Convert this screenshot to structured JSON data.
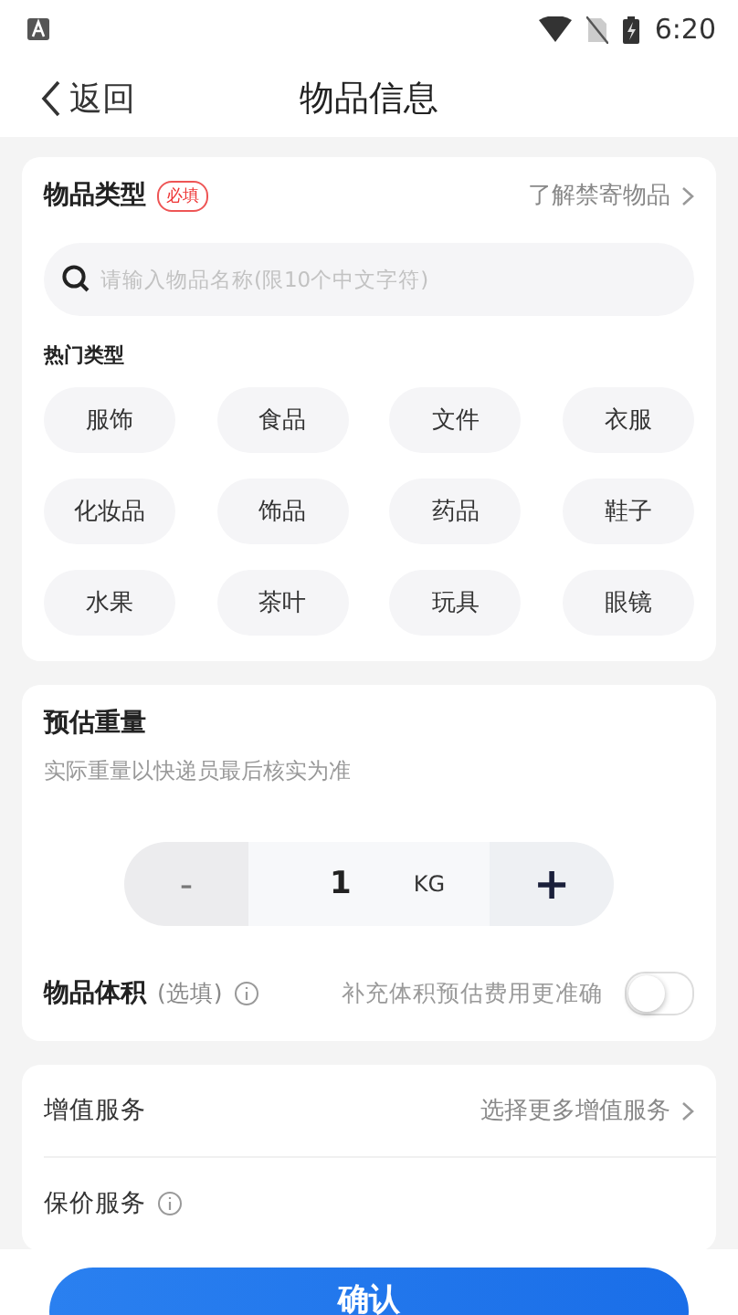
{
  "status_bar": {
    "time": "6:20"
  },
  "header": {
    "back": "返回",
    "title": "物品信息"
  },
  "item_type": {
    "title": "物品类型",
    "badge": "必填",
    "link": "了解禁寄物品",
    "search": {
      "placeholder": "请输入物品名称(限10个中文字符)"
    },
    "hot_label": "热门类型",
    "categories": [
      "服饰",
      "食品",
      "文件",
      "衣服",
      "化妆品",
      "饰品",
      "药品",
      "鞋子",
      "水果",
      "茶叶",
      "玩具",
      "眼镜"
    ]
  },
  "weight": {
    "title": "预估重量",
    "hint": "实际重量以快递员最后核实为准",
    "minus": "-",
    "value": "1",
    "unit": "KG",
    "plus": "+"
  },
  "volume": {
    "title": "物品体积",
    "optional": "(选填)",
    "hint": "补充体积预估费用更准确",
    "on": false
  },
  "services": [
    {
      "label": "增值服务",
      "link": "选择更多增值服务",
      "info": false
    },
    {
      "label": "保价服务",
      "info": true
    }
  ],
  "confirm": "确认"
}
